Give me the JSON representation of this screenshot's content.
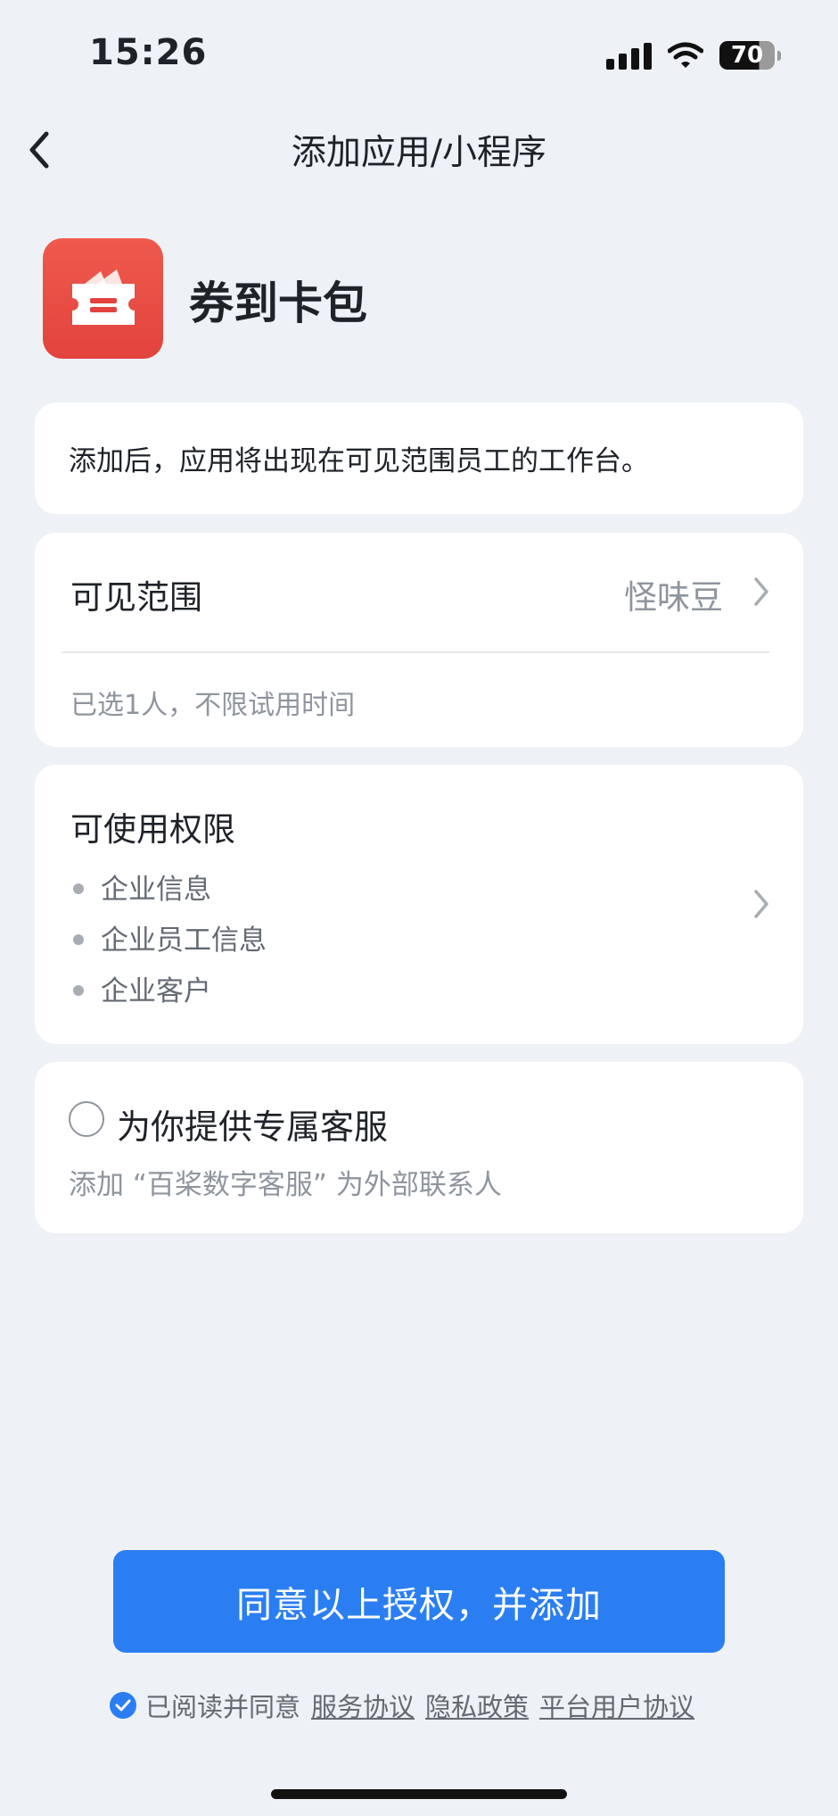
{
  "status_bar": {
    "time": "15:26",
    "battery": "70"
  },
  "nav": {
    "back_icon": "chevron-left-icon",
    "title": "添加应用/小程序"
  },
  "app": {
    "name": "券到卡包",
    "icon": "ticket-wallet-icon",
    "icon_color": "#e8473f"
  },
  "notice": "添加后，应用将出现在可见范围员工的工作台。",
  "visibility": {
    "label": "可见范围",
    "value": "怪味豆",
    "note": "已选1人，不限试用时间"
  },
  "permissions": {
    "label": "可使用权限",
    "items": [
      "企业信息",
      "企业员工信息",
      "企业客户"
    ]
  },
  "service": {
    "label": "为你提供专属客服",
    "note": "添加 “百桨数字客服” 为外部联系人",
    "checked": false
  },
  "agree_button": "同意以上授权，并添加",
  "agreement": {
    "prefix": "已阅读并同意",
    "checked": true,
    "links": [
      "服务协议",
      "隐私政策",
      "平台用户协议"
    ]
  },
  "colors": {
    "accent": "#2a7ef2",
    "background": "#eef1f6"
  }
}
